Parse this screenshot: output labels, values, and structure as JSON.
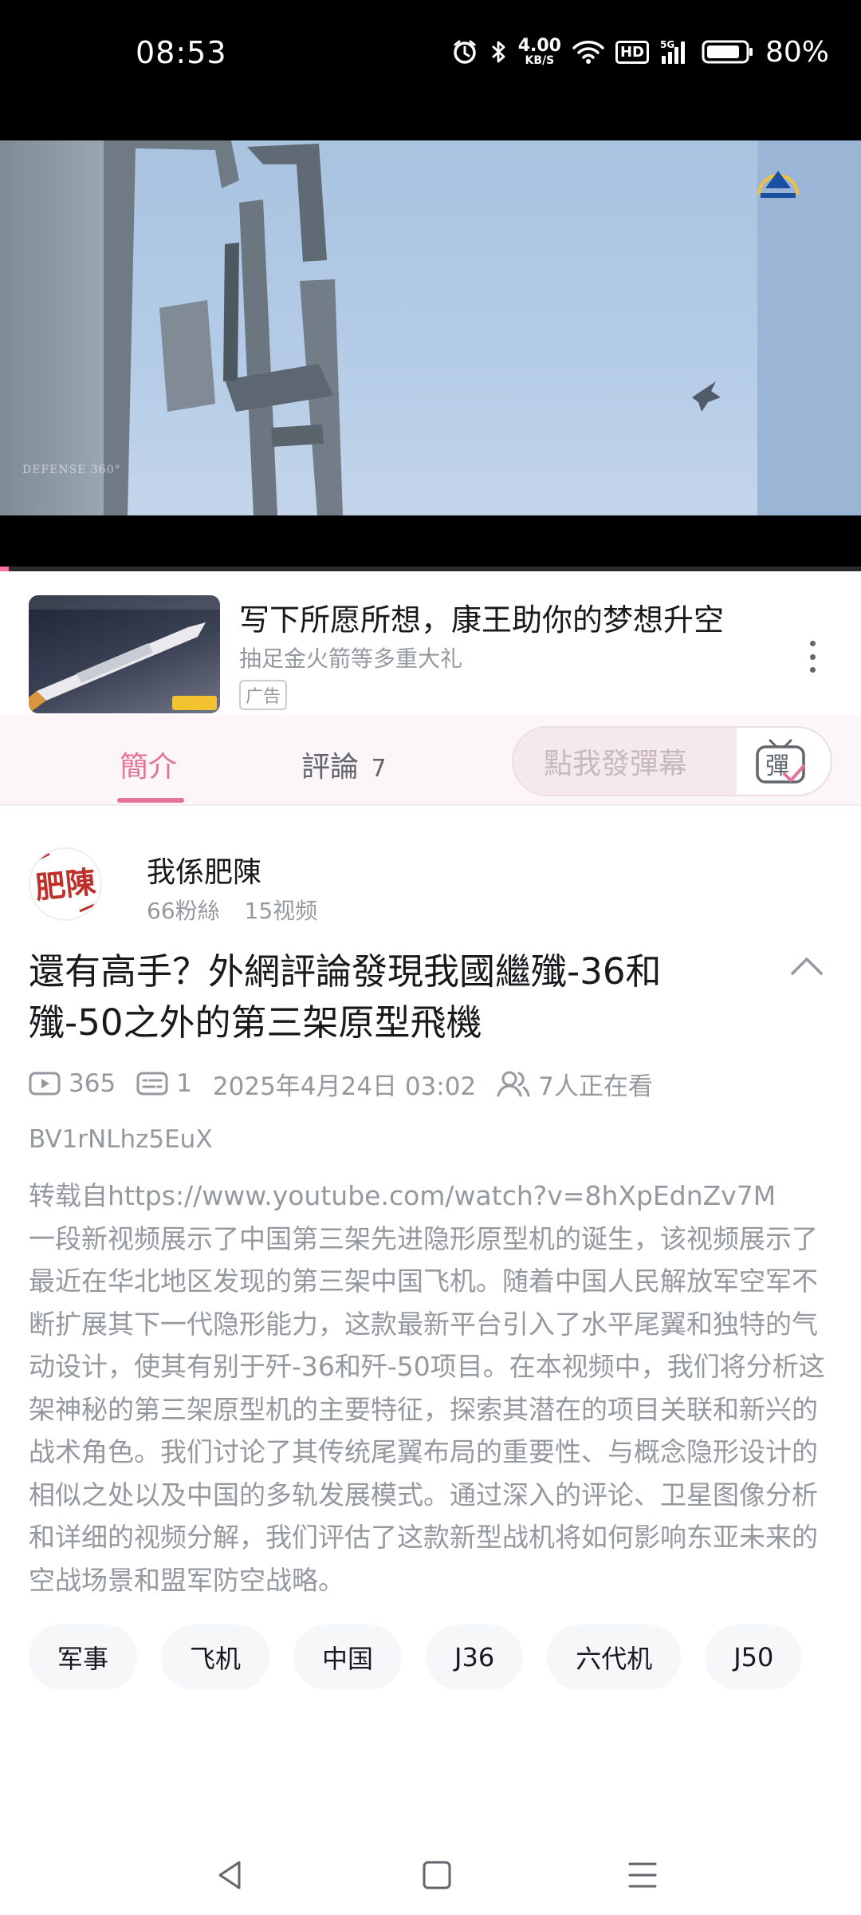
{
  "status_bar": {
    "time": "08:53",
    "net_speed_value": "4.00",
    "net_speed_unit": "KB/S",
    "hd_label": "HD",
    "network_label": "5G",
    "battery_percent": "80%",
    "icons": [
      "alarm-icon",
      "bluetooth-icon",
      "wifi-icon",
      "signal-icon",
      "battery-icon"
    ]
  },
  "video": {
    "watermark": "DEFENSE 360°",
    "progress": 0.01,
    "accent_color": "#fb7299"
  },
  "ad": {
    "title": "写下所愿所想，康王助你的梦想升空",
    "subtitle": "抽足金火箭等多重大礼",
    "badge": "广告"
  },
  "tabs": {
    "intro_label": "簡介",
    "comments_label": "評論",
    "comments_count": "7",
    "danmaku_placeholder": "點我發彈幕",
    "danmaku_icon_char": "彈"
  },
  "uploader": {
    "name": "我係肥陳",
    "followers": "66粉絲",
    "videos": "15视频",
    "avatar_text": "肥陳"
  },
  "video_info": {
    "title": "還有高手？外網評論發現我國繼殲-36和殲-50之外的第三架原型飛機",
    "views": "365",
    "danmaku_count": "1",
    "date": "2025年4月24日 03:02",
    "watching": "7人正在看",
    "bvid": "BV1rNLhz5EuX",
    "description": "转载自https://www.youtube.com/watch?v=8hXpEdnZv7M\n一段新视频展示了中国第三架先进隐形原型机的诞生，该视频展示了最近在华北地区发现的第三架中国飞机。随着中国人民解放军空军不断扩展其下一代隐形能力，这款最新平台引入了水平尾翼和独特的气动设计，使其有别于歼-36和歼-50项目。在本视频中，我们将分析这架神秘的第三架原型机的主要特征，探索其潜在的项目关联和新兴的战术角色。我们讨论了其传统尾翼布局的重要性、与概念隐形设计的相似之处以及中国的多轨发展模式。通过深入的评论、卫星图像分析和详细的视频分解，我们评估了这款新型战机将如何影响东亚未来的空战场景和盟军防空战略。"
  },
  "tags": [
    "军事",
    "飞机",
    "中国",
    "J36",
    "六代机",
    "J50"
  ],
  "colors": {
    "accent_pink": "#e3739a",
    "text_primary": "#18191c",
    "text_secondary": "#9499a0",
    "tag_bg": "#f6f7f8"
  }
}
